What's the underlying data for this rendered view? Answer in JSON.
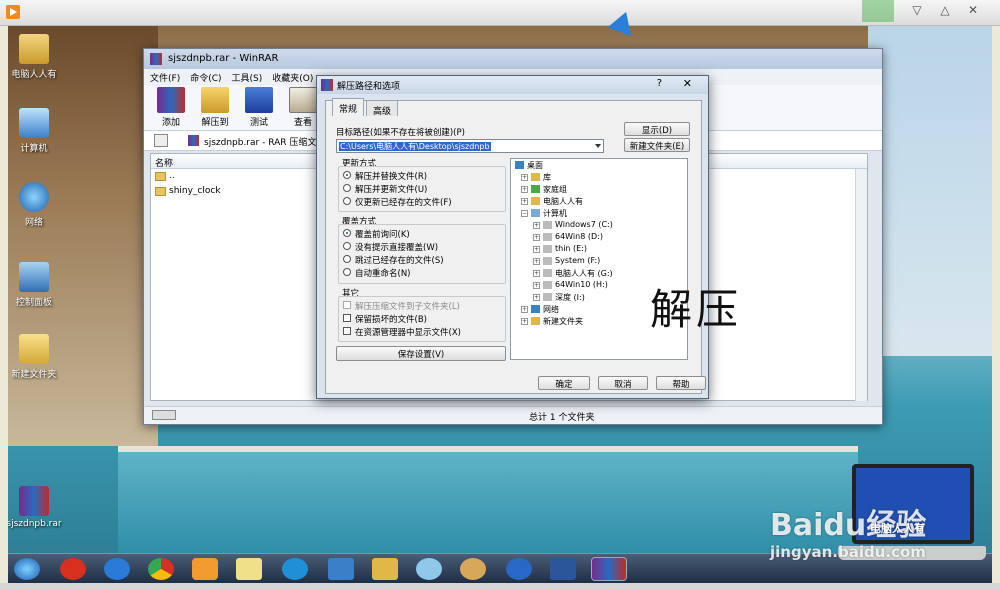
{
  "desktop": {
    "icons": [
      {
        "label": "电脑人人有"
      },
      {
        "label": "计算机"
      },
      {
        "label": "网络"
      },
      {
        "label": "控制面板"
      },
      {
        "label": "新建文件夹"
      },
      {
        "label": "sjszdnpb.rar"
      }
    ]
  },
  "winrar": {
    "title": "sjszdnpb.rar - WinRAR",
    "menu": [
      "文件(F)",
      "命令(C)",
      "工具(S)",
      "收藏夹(O)"
    ],
    "toolbar": [
      "添加",
      "解压到",
      "测试",
      "查看"
    ],
    "path": "sjszdnpb.rar - RAR 压缩文件, 解",
    "list_header": "名称",
    "rows": [
      "..",
      "shiny_clock"
    ],
    "status": "总计 1 个文件夹"
  },
  "dialog": {
    "title": "解压路径和选项",
    "help_glyph": "?",
    "close_glyph": "✕",
    "tabs": [
      "常规",
      "高级"
    ],
    "target_label": "目标路径(如果不存在将被创建)(P)",
    "target_value": "C:\\Users\\电脑人人有\\Desktop\\sjszdnpb",
    "show_button": "显示(D)",
    "new_folder_button": "新建文件夹(E)",
    "update_group": {
      "title": "更新方式",
      "options": [
        "解压并替换文件(R)",
        "解压并更新文件(U)",
        "仅更新已经存在的文件(F)"
      ],
      "selected": 0
    },
    "overwrite_group": {
      "title": "覆盖方式",
      "options": [
        "覆盖前询问(K)",
        "没有提示直接覆盖(W)",
        "跳过已经存在的文件(S)",
        "自动重命名(N)"
      ],
      "selected": 0
    },
    "misc_group": {
      "title": "其它",
      "options": [
        "解压压缩文件到子文件夹(L)",
        "保留损坏的文件(B)",
        "在资源管理器中显示文件(X)"
      ]
    },
    "save_button": "保存设置(V)",
    "tree": [
      {
        "label": "桌面",
        "level": 0,
        "icon": "desktop-icon"
      },
      {
        "label": "库",
        "level": 1,
        "icon": "library-icon"
      },
      {
        "label": "家庭组",
        "level": 1,
        "icon": "homegroup-icon"
      },
      {
        "label": "电脑人人有",
        "level": 1,
        "icon": "user-folder-icon"
      },
      {
        "label": "计算机",
        "level": 1,
        "icon": "computer-icon"
      },
      {
        "label": "Windows7 (C:)",
        "level": 2,
        "icon": "drive-icon"
      },
      {
        "label": "64Win8  (D:)",
        "level": 2,
        "icon": "drive-icon"
      },
      {
        "label": "thin (E:)",
        "level": 2,
        "icon": "drive-icon"
      },
      {
        "label": "System (F:)",
        "level": 2,
        "icon": "drive-icon"
      },
      {
        "label": "电脑人人有 (G:)",
        "level": 2,
        "icon": "drive-icon"
      },
      {
        "label": "64Win10 (H:)",
        "level": 2,
        "icon": "drive-icon"
      },
      {
        "label": "深度 (I:)",
        "level": 2,
        "icon": "drive-icon"
      },
      {
        "label": "网络",
        "level": 1,
        "icon": "network-icon"
      },
      {
        "label": "新建文件夹",
        "level": 1,
        "icon": "folder-icon"
      }
    ],
    "ok": "确定",
    "cancel": "取消",
    "help": "帮助"
  },
  "overlay": {
    "caption": "解压",
    "watermark_brand": "Baidu经验",
    "watermark_url": "jingyan.baidu.com",
    "laptop_text": "电脑人人有"
  },
  "player": {
    "controls": [
      "▽",
      "△",
      "✕"
    ]
  },
  "colors": {
    "title_bar": "#c8d6e6",
    "taskbar": "#1f2e44",
    "selection": "#3366cc"
  }
}
